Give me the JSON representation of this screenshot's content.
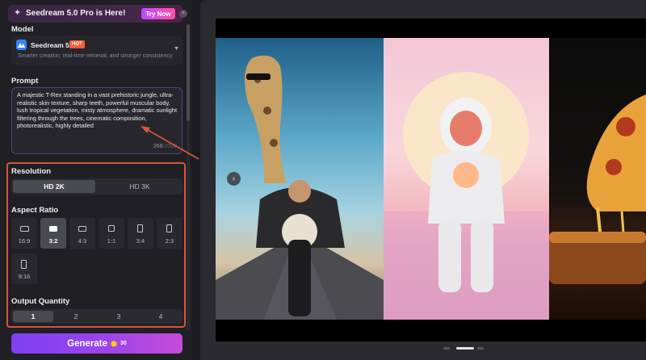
{
  "banner": {
    "title": "Seedream 5.0 Pro is Here!",
    "cta": "Try Now",
    "close": "×",
    "spark": "✦"
  },
  "model": {
    "section_label": "Model",
    "name": "Seedream 5.0",
    "badge": "HOT",
    "description": "Smarter creation, real-time retrieval, and stronger consistency",
    "caret": "▼"
  },
  "prompt": {
    "section_label": "Prompt",
    "value": "A majestic T-Rex standing in a vast prehistoric jungle, ultra-realistic skin texture, sharp teeth, powerful muscular body, lush tropical vegetation, misty atmosphere, dramatic sunlight filtering through the trees, cinematic composition, photorealistic, highly detailed",
    "count": "268",
    "max": "/2000"
  },
  "resolution": {
    "section_label": "Resolution",
    "options": [
      {
        "label": "HD 2K",
        "selected": true
      },
      {
        "label": "HD 3K",
        "selected": false
      }
    ]
  },
  "aspect_ratio": {
    "section_label": "Aspect Ratio",
    "options": [
      {
        "label": "16:9",
        "selected": false
      },
      {
        "label": "3:2",
        "selected": true
      },
      {
        "label": "4:3",
        "selected": false
      },
      {
        "label": "1:1",
        "selected": false
      },
      {
        "label": "3:4",
        "selected": false
      },
      {
        "label": "2:3",
        "selected": false
      },
      {
        "label": "9:16",
        "selected": false
      }
    ]
  },
  "quantity": {
    "section_label": "Output Quantity",
    "options": [
      {
        "label": "1",
        "selected": true
      },
      {
        "label": "2",
        "selected": false
      },
      {
        "label": "3",
        "selected": false
      },
      {
        "label": "4",
        "selected": false
      }
    ]
  },
  "generate": {
    "label": "Generate",
    "cost": "30"
  },
  "gallery": {
    "prev_icon": "‹",
    "active_slide": 2,
    "slide_count": 3
  },
  "colors": {
    "accent": "#8b45f0",
    "highlight_border": "#d9553c",
    "hot_badge": "#ff5a36"
  }
}
